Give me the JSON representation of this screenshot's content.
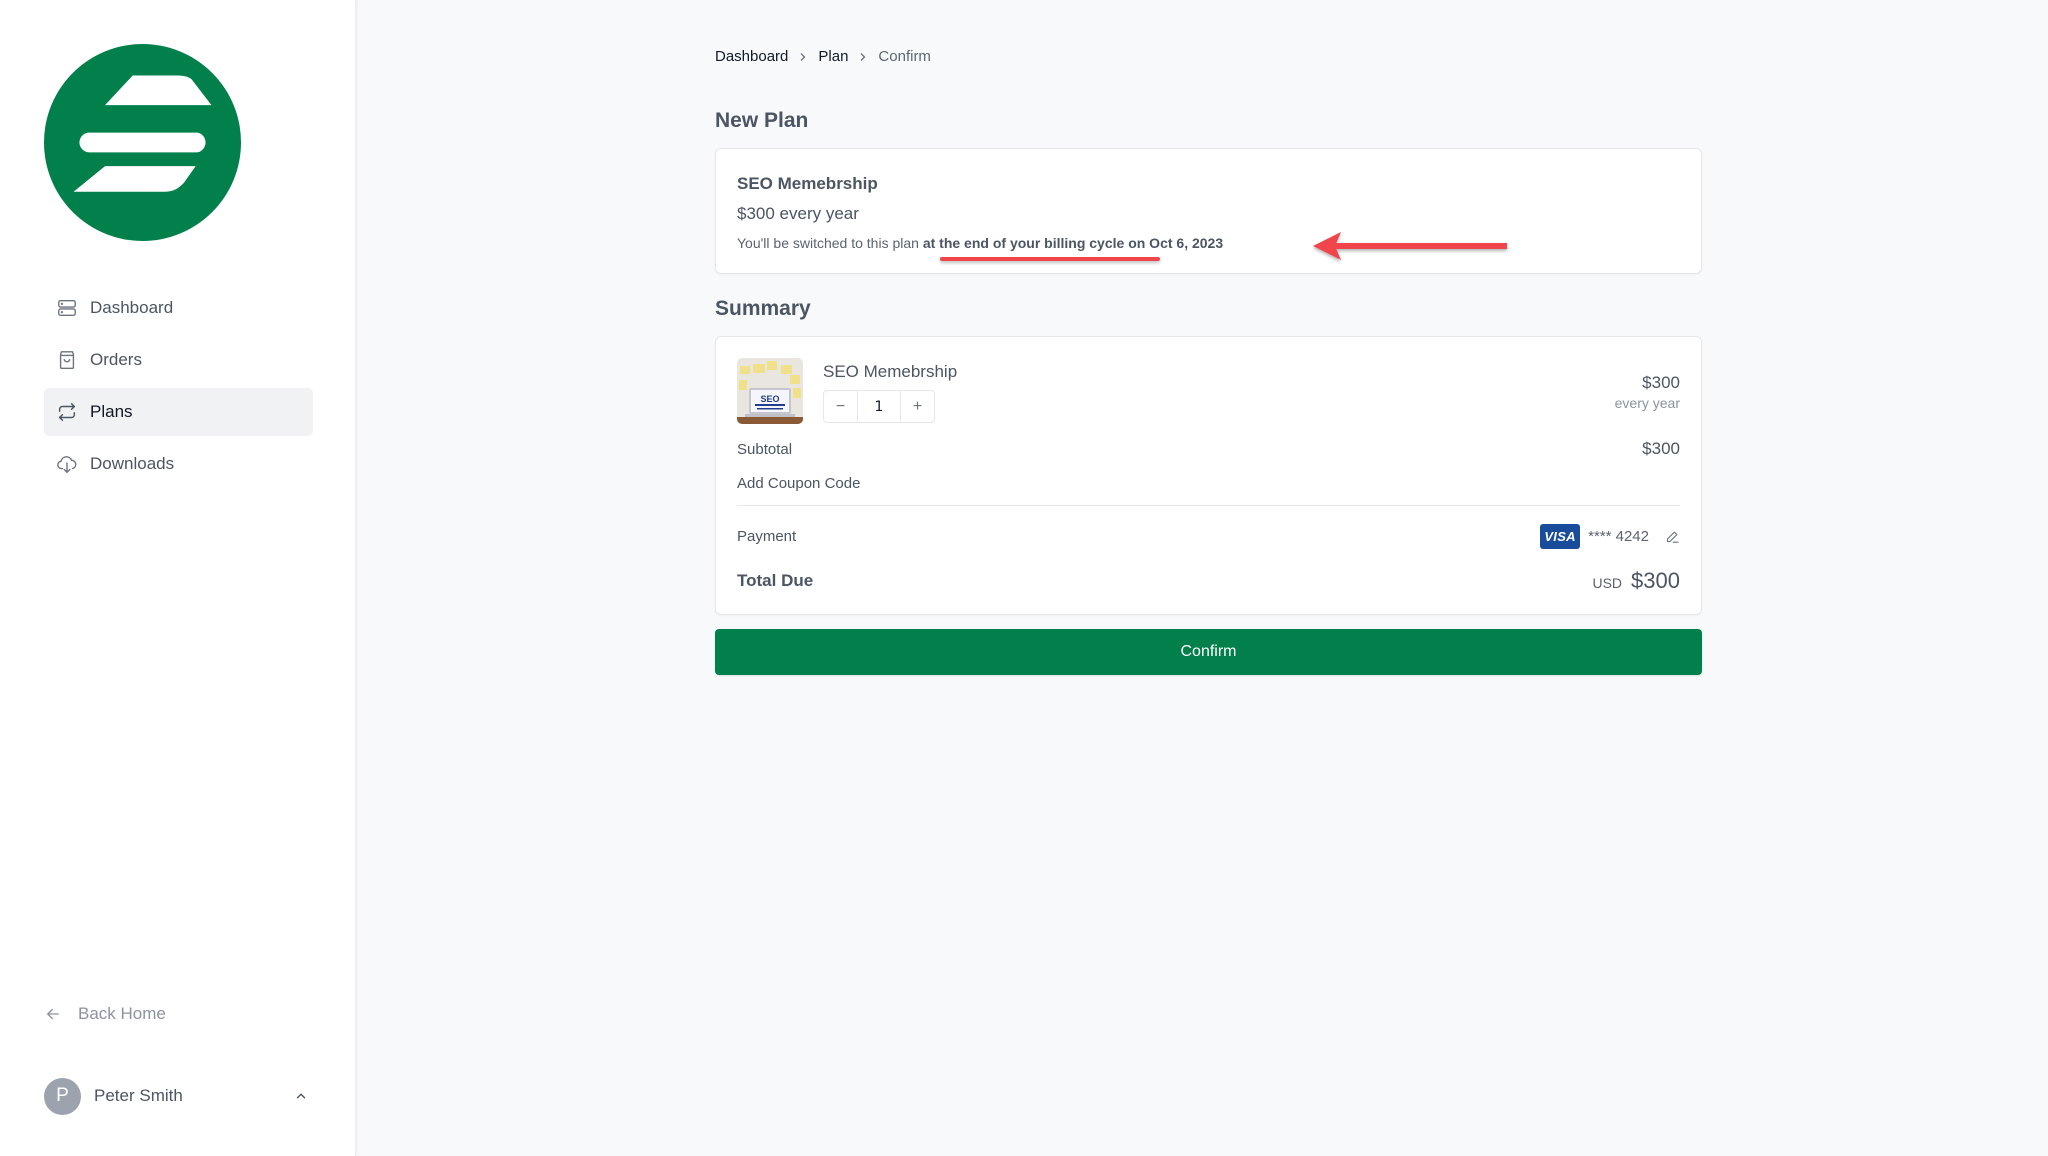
{
  "brand": {
    "logo_icon": "brand-s-logo",
    "color": "#02804c"
  },
  "sidebar": {
    "items": [
      {
        "label": "Dashboard",
        "icon": "server-stack-icon",
        "active": false
      },
      {
        "label": "Orders",
        "icon": "shopping-bag-icon",
        "active": false
      },
      {
        "label": "Plans",
        "icon": "arrows-repeat-icon",
        "active": true
      },
      {
        "label": "Downloads",
        "icon": "cloud-download-icon",
        "active": false
      }
    ],
    "back_home": {
      "label": "Back Home",
      "icon": "arrow-left-icon"
    },
    "user": {
      "initial": "P",
      "name": "Peter Smith",
      "icon": "chevron-up-icon"
    }
  },
  "breadcrumb": [
    {
      "label": "Dashboard"
    },
    {
      "label": "Plan"
    },
    {
      "label": "Confirm"
    }
  ],
  "new_plan": {
    "title": "New Plan",
    "name": "SEO Memebrship",
    "price": "$300 every year",
    "note_prefix": "You'll be switched to this plan ",
    "note_bold": "at the end of your billing cycle on Oct 6, 2023"
  },
  "summary": {
    "title": "Summary",
    "item": {
      "name": "SEO Memebrship",
      "quantity": "1",
      "minus": "−",
      "plus": "+",
      "price": "$300",
      "period": "every year",
      "thumbnail_alt": "SEO Search Engine Optimization laptop"
    },
    "subtotal_label": "Subtotal",
    "subtotal_value": "$300",
    "coupon_label": "Add Coupon Code",
    "payment_label": "Payment",
    "card_brand": "VISA",
    "card_mask": "**** 4242",
    "total_label": "Total Due",
    "total_currency": "USD",
    "total_value": "$300"
  },
  "confirm_button": {
    "label": "Confirm"
  },
  "annotation": {
    "color": "#f0454b"
  }
}
